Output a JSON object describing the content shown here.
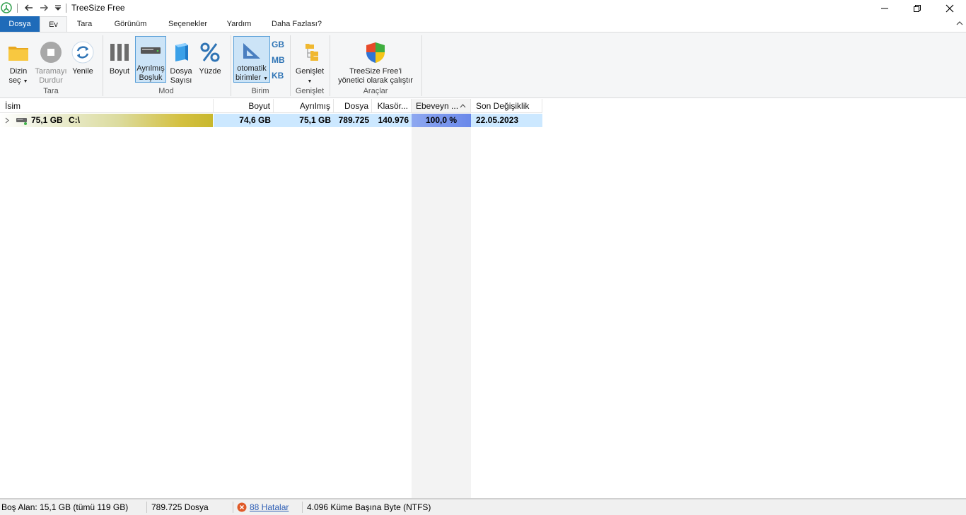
{
  "window": {
    "title": "TreeSize Free"
  },
  "tabs": [
    {
      "label": "Dosya"
    },
    {
      "label": "Ev"
    },
    {
      "label": "Tara"
    },
    {
      "label": "Görünüm"
    },
    {
      "label": "Seçenekler"
    },
    {
      "label": "Yardım"
    },
    {
      "label": "Daha Fazlası?"
    }
  ],
  "ribbon": {
    "tara": {
      "group_label": "Tara",
      "dizin_sec_line1": "Dizin",
      "dizin_sec_line2": "seç",
      "durdur_line1": "Taramayı",
      "durdur_line2": "Durdur",
      "yenile": "Yenile"
    },
    "mod": {
      "group_label": "Mod",
      "boyut": "Boyut",
      "ayrilmis_line1": "Ayrılmış",
      "ayrilmis_line2": "Boşluk",
      "dosya_line1": "Dosya",
      "dosya_line2": "Sayısı",
      "yuzde": "Yüzde"
    },
    "birim": {
      "group_label": "Birim",
      "oto_line1": "otomatik",
      "oto_line2": "birimler",
      "gb": "GB",
      "mb": "MB",
      "kb": "KB"
    },
    "genislet": {
      "group_label": "Genişlet",
      "label": "Genişlet"
    },
    "araclar": {
      "group_label": "Araçlar",
      "admin_line1": "TreeSize Free'i",
      "admin_line2": "yönetici olarak çalıştır"
    }
  },
  "grid": {
    "columns": [
      "İsim",
      "Boyut",
      "Ayrılmış",
      "Dosya",
      "Klasör...",
      "Ebeveyn ...",
      "Son Değişiklik"
    ],
    "rows": [
      {
        "size_label": "75,1 GB",
        "name": "C:\\",
        "boyut": "74,6 GB",
        "ayrilmis": "75,1 GB",
        "dosya": "789.725",
        "klasor": "140.976",
        "ebeveyn": "100,0 %",
        "son_degisiklik": "22.05.2023"
      }
    ]
  },
  "status": {
    "free_space": "Boş Alan: 15,1 GB  (tümü 119 GB)",
    "files": "789.725 Dosya",
    "errors": "88 Hatalar",
    "cluster": "4.096 Küme Başına Byte (NTFS)"
  },
  "colors": {
    "file_tab": "#1f6bb9",
    "selection": "#cce8ff",
    "accent": "#2f74b5"
  }
}
